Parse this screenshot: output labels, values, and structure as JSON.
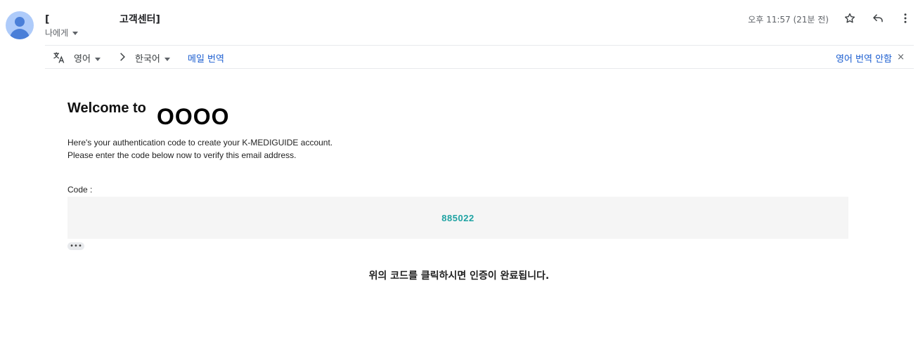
{
  "header": {
    "sender_prefix": "[",
    "sender_name": "고객센터]",
    "recipient_label": "나에게",
    "timestamp": "오후 11:57 (21분 전)",
    "icons": [
      "avatar-icon",
      "star-icon",
      "reply-icon",
      "more-vert-icon"
    ]
  },
  "translate_bar": {
    "source_language": "영어",
    "target_language": "한국어",
    "translate_link": "메일 번역",
    "no_translate_link": "영어 번역 안함",
    "close_symbol": "×",
    "icons": [
      "translate-icon",
      "chevron-right-icon",
      "close-icon"
    ]
  },
  "email": {
    "welcome_text": "Welcome to",
    "brand_text": "OOOO",
    "intro_line1": "Here's your authentication code to create your K-MEDIGUIDE account.",
    "intro_line2": "Please enter the code below now to verify this email address.",
    "code_label": "Code :",
    "code_value": "885022",
    "ellipsis": "•••",
    "footer_message": "위의 코드를 클릭하시면 인증이 완료됩니다."
  },
  "colors": {
    "link": "#1a5dd0",
    "code": "#1fa3a3",
    "code_box_bg": "#f5f5f5",
    "avatar_bg": "#aecbfa",
    "avatar_fg": "#4a7fd8"
  }
}
